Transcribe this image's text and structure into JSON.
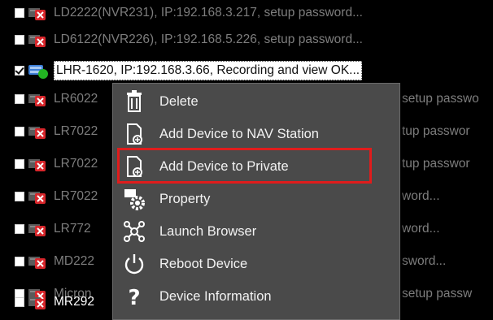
{
  "device_list": {
    "rows": [
      {
        "text": "LD2222(NVR231), IP:192.168.3.217, setup password...",
        "icon": "device-offline-icon",
        "checked": false
      },
      {
        "text": "LD6122(NVR226), IP:192.168.5.226, setup password...",
        "icon": "device-offline-icon",
        "checked": false
      },
      {
        "text": "LHR-1620, IP:192.168.3.66, Recording and view OK...",
        "icon": "device-online-icon",
        "checked": true
      },
      {
        "text": "LR6022",
        "tail": "setup passwo",
        "icon": "device-offline-icon",
        "checked": false
      },
      {
        "text": "LR7022",
        "tail": "tup passwor",
        "icon": "device-offline-icon",
        "checked": false
      },
      {
        "text": "LR7022",
        "tail": "tup passwor",
        "icon": "device-offline-icon",
        "checked": false
      },
      {
        "text": "LR7022",
        "tail": "word...",
        "icon": "device-offline-icon",
        "checked": false
      },
      {
        "text": "LR772",
        "tail": "word...",
        "icon": "device-offline-icon",
        "checked": false
      },
      {
        "text": "MD222",
        "tail": "sword...",
        "icon": "device-offline-icon",
        "checked": false
      },
      {
        "text": "Micron",
        "tail": "setup passw",
        "icon": "device-offline-icon",
        "checked": false
      },
      {
        "text": "MR292",
        "icon": "device-offline-icon",
        "checked": false
      }
    ]
  },
  "context_menu": {
    "items": [
      {
        "label": "Delete",
        "icon": "trash-icon"
      },
      {
        "label": "Add Device to NAV Station",
        "icon": "add-document-icon"
      },
      {
        "label": "Add Device to Private",
        "icon": "add-document-icon"
      },
      {
        "label": "Property",
        "icon": "property-gear-icon"
      },
      {
        "label": "Launch Browser",
        "icon": "network-icon"
      },
      {
        "label": "Reboot Device",
        "icon": "power-icon"
      },
      {
        "label": "Device Information",
        "icon": "question-icon"
      }
    ],
    "highlighted_item": "Add Device to Private"
  },
  "colors": {
    "background": "#000000",
    "menu_background": "#4a4a4a",
    "highlight_border": "#e01c1c",
    "status_online": "#22b422",
    "status_offline": "#d8262b"
  }
}
